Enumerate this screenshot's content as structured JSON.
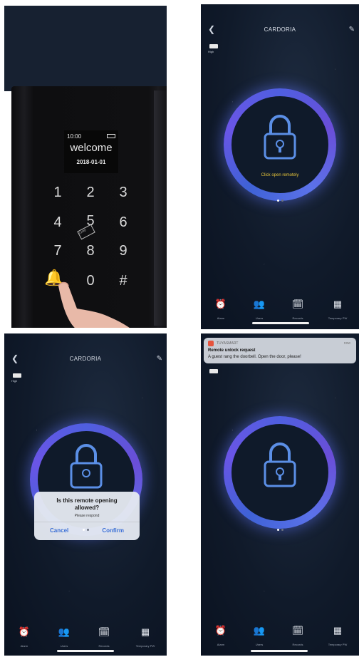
{
  "keypad": {
    "time": "10:00",
    "welcome": "welcome",
    "date": "2018-01-01",
    "keys": [
      "1",
      "2",
      "3",
      "4",
      "5",
      "6",
      "7",
      "8",
      "9",
      "0",
      "#"
    ],
    "card_label": "CARD"
  },
  "app": {
    "title": "CARDORIA",
    "battery_label": "High",
    "hint": "Click open remotely",
    "tabs": [
      {
        "label": "Alarm",
        "icon": "alarm-icon"
      },
      {
        "label": "Users",
        "icon": "users-icon"
      },
      {
        "label": "Records",
        "icon": "records-icon"
      },
      {
        "label": "Temporary PW",
        "icon": "grid-icon"
      }
    ],
    "colors": {
      "ring": "#5b63e6",
      "hint": "#e7c53a",
      "confirm": "#3b6fd6"
    }
  },
  "dialog": {
    "question": "Is this remote opening allowed?",
    "subtitle": "Please respond",
    "cancel": "Cancel",
    "confirm": "Confirm"
  },
  "notification": {
    "app": "TUYASMART",
    "time": "now",
    "title": "Remote unlock request",
    "body": "A guest rang the doorbell. Open the door, please!"
  }
}
